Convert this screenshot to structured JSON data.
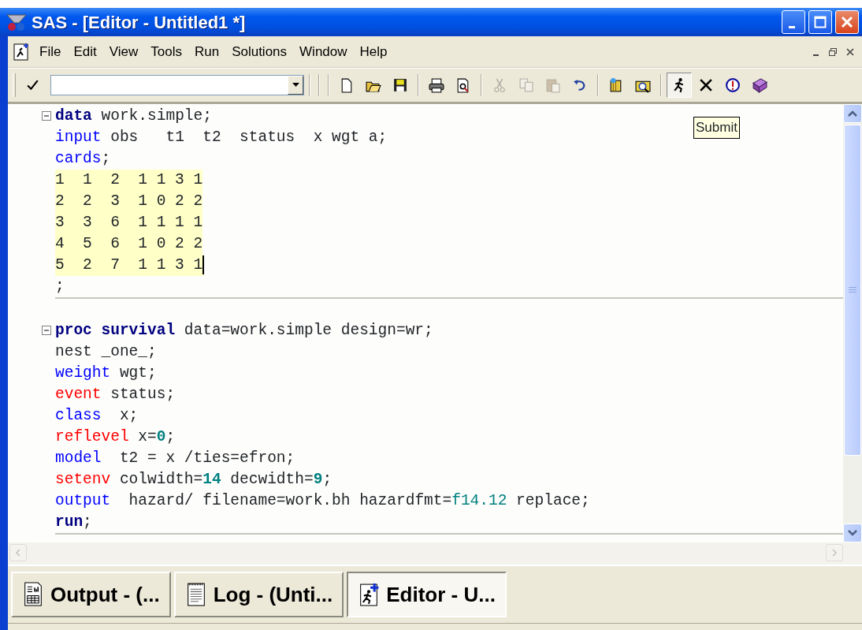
{
  "window": {
    "title": "SAS - [Editor - Untitled1 *]"
  },
  "menu": [
    "File",
    "Edit",
    "View",
    "Tools",
    "Run",
    "Solutions",
    "Window",
    "Help"
  ],
  "toolbar": {
    "groups": [
      [
        {
          "disabled": false,
          "pressed": false
        }
      ],
      [
        {
          "disabled": false,
          "pressed": false
        },
        {
          "disabled": false,
          "pressed": false
        },
        {
          "disabled": false,
          "pressed": false
        }
      ],
      [
        {
          "disabled": false,
          "pressed": false
        },
        {
          "disabled": false,
          "pressed": false
        }
      ],
      [
        {
          "disabled": true,
          "pressed": false
        },
        {
          "disabled": true,
          "pressed": false
        },
        {
          "disabled": true,
          "pressed": false
        },
        {
          "disabled": false,
          "pressed": false
        }
      ],
      [
        {
          "disabled": false,
          "pressed": false
        },
        {
          "disabled": false,
          "pressed": false
        }
      ],
      [
        {
          "disabled": false,
          "pressed": true
        },
        {
          "disabled": false,
          "pressed": false
        },
        {
          "disabled": false,
          "pressed": false
        },
        {
          "disabled": false,
          "pressed": false
        }
      ]
    ]
  },
  "editor": {
    "blocks": [
      {
        "expanded": true,
        "lines": [
          {
            "kind": "code",
            "tokens": [
              {
                "kind": "keyword",
                "text": "data"
              },
              {
                "kind": "plain",
                "text": " work.simple;"
              }
            ]
          },
          {
            "kind": "code",
            "tokens": [
              {
                "kind": "statement",
                "text": "input"
              },
              {
                "kind": "plain",
                "text": " obs   t1  t2  status  x wgt a;"
              }
            ]
          },
          {
            "kind": "code",
            "tokens": [
              {
                "kind": "statement",
                "text": "cards"
              },
              {
                "kind": "plain",
                "text": ";"
              }
            ]
          },
          {
            "kind": "data",
            "text": "1  1  2  1 1 3 1",
            "cursor": false
          },
          {
            "kind": "data",
            "text": "2  2  3  1 0 2 2",
            "cursor": false
          },
          {
            "kind": "data",
            "text": "3  3  6  1 1 1 1",
            "cursor": false
          },
          {
            "kind": "data",
            "text": "4  5  6  1 0 2 2",
            "cursor": false
          },
          {
            "kind": "data",
            "text": "5  2  7  1 1 3 1",
            "cursor": true
          },
          {
            "kind": "code",
            "tokens": [
              {
                "kind": "plain",
                "text": ";"
              }
            ]
          }
        ]
      },
      {
        "expanded": true,
        "lines": [
          {
            "kind": "code",
            "tokens": [
              {
                "kind": "keyword",
                "text": "proc survival"
              },
              {
                "kind": "plain",
                "text": " data=work.simple design=wr;"
              }
            ]
          },
          {
            "kind": "code",
            "tokens": [
              {
                "kind": "plain",
                "text": "nest _one_;"
              }
            ]
          },
          {
            "kind": "code",
            "tokens": [
              {
                "kind": "statement",
                "text": "weight"
              },
              {
                "kind": "plain",
                "text": " wgt;"
              }
            ]
          },
          {
            "kind": "code",
            "tokens": [
              {
                "kind": "special",
                "text": "event"
              },
              {
                "kind": "plain",
                "text": " status;"
              }
            ]
          },
          {
            "kind": "code",
            "tokens": [
              {
                "kind": "statement",
                "text": "class"
              },
              {
                "kind": "plain",
                "text": "  x;"
              }
            ]
          },
          {
            "kind": "code",
            "tokens": [
              {
                "kind": "special",
                "text": "reflevel"
              },
              {
                "kind": "plain",
                "text": " x="
              },
              {
                "kind": "number",
                "text": "0"
              },
              {
                "kind": "plain",
                "text": ";"
              }
            ]
          },
          {
            "kind": "code",
            "tokens": [
              {
                "kind": "statement",
                "text": "model"
              },
              {
                "kind": "plain",
                "text": "  t2 = x /ties=efron;"
              }
            ]
          },
          {
            "kind": "code",
            "tokens": [
              {
                "kind": "special",
                "text": "setenv"
              },
              {
                "kind": "plain",
                "text": " colwidth="
              },
              {
                "kind": "number",
                "text": "14"
              },
              {
                "kind": "plain",
                "text": " decwidth="
              },
              {
                "kind": "number",
                "text": "9"
              },
              {
                "kind": "plain",
                "text": ";"
              }
            ]
          },
          {
            "kind": "code",
            "tokens": [
              {
                "kind": "statement",
                "text": "output"
              },
              {
                "kind": "plain",
                "text": "  hazard/ filename=work.bh hazardfmt="
              },
              {
                "kind": "format",
                "text": "f14.12"
              },
              {
                "kind": "plain",
                "text": " replace;"
              }
            ]
          },
          {
            "kind": "code",
            "tokens": [
              {
                "kind": "keyword",
                "text": "run"
              },
              {
                "kind": "plain",
                "text": ";"
              }
            ]
          }
        ]
      }
    ],
    "tooltip": "Submit"
  },
  "taskbar": [
    {
      "kind": "output",
      "label": "Output - (...",
      "selected": false
    },
    {
      "kind": "log",
      "label": "Log - (Unti...",
      "selected": false
    },
    {
      "kind": "editor",
      "label": "Editor - U...",
      "selected": true
    }
  ]
}
